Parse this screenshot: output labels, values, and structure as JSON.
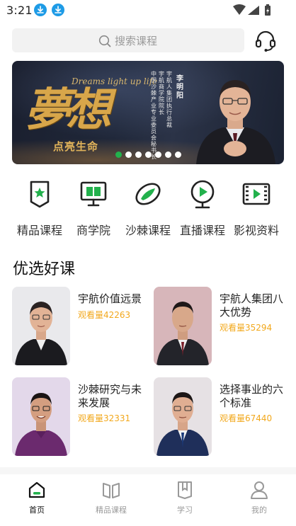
{
  "status_bar": {
    "time": "3:21"
  },
  "search": {
    "placeholder": "搜索课程"
  },
  "banner": {
    "calligraphy": "夢想",
    "english": "Dreams light up life",
    "slogan": "点亮生命",
    "name": "李明阳",
    "vertical_lines": [
      "宇航人集团执行总裁",
      "宇航商学院院长",
      "中国沙棘产业专业委员会秘书长"
    ],
    "slide_count": 7,
    "active_slide": 1
  },
  "categories": [
    {
      "label": "精品课程",
      "icon": "star-badge-icon"
    },
    {
      "label": "商学院",
      "icon": "book-monitor-icon"
    },
    {
      "label": "沙棘课程",
      "icon": "leaf-icon"
    },
    {
      "label": "直播课程",
      "icon": "live-play-icon"
    },
    {
      "label": "影视资料",
      "icon": "film-icon"
    }
  ],
  "section": {
    "title": "优选好课"
  },
  "courses": [
    {
      "title": "宇航价值远景",
      "views": "观看量42263"
    },
    {
      "title": "宇航人集团八大优势",
      "views": "观看量35294"
    },
    {
      "title": "沙棘研究与未来发展",
      "views": "观看量32331"
    },
    {
      "title": "选择事业的六个标准",
      "views": "观看量67440"
    }
  ],
  "tabs": [
    {
      "label": "首页",
      "icon": "home-icon",
      "active": true
    },
    {
      "label": "精品课程",
      "icon": "open-book-icon",
      "active": false
    },
    {
      "label": "学习",
      "icon": "bookmark-icon",
      "active": false
    },
    {
      "label": "我的",
      "icon": "user-icon",
      "active": false
    }
  ],
  "colors": {
    "accent_green": "#22b14c",
    "views_orange": "#f2a81c",
    "download_blue": "#1e9be6"
  }
}
